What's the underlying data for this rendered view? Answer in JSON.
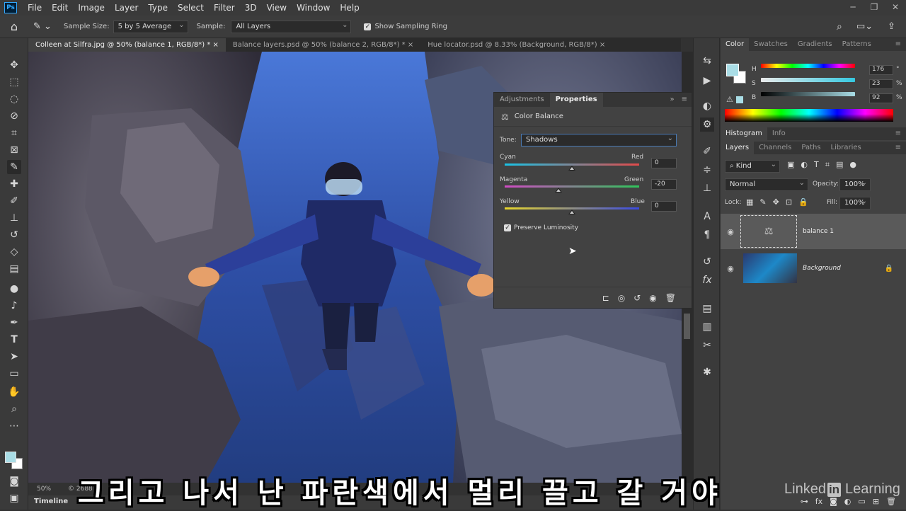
{
  "menu": {
    "logo": "Ps",
    "items": [
      "File",
      "Edit",
      "Image",
      "Layer",
      "Type",
      "Select",
      "Filter",
      "3D",
      "View",
      "Window",
      "Help"
    ]
  },
  "window_controls": [
    "─",
    "❐",
    "✕"
  ],
  "options": {
    "sample_size_label": "Sample Size:",
    "sample_size_value": "5 by 5 Average",
    "sample_label": "Sample:",
    "sample_value": "All Layers",
    "show_ring_label": "Show Sampling Ring"
  },
  "tabs": [
    {
      "label": "Colleen at Silfra.jpg @ 50% (balance 1, RGB/8*) *",
      "close": "×"
    },
    {
      "label": "Balance layers.psd @ 50% (balance 2, RGB/8*) *",
      "close": "×"
    },
    {
      "label": "Hue locator.psd @ 8.33% (Background, RGB/8*)",
      "close": "×"
    }
  ],
  "properties": {
    "tab_adjustments": "Adjustments",
    "tab_properties": "Properties",
    "title": "Color Balance",
    "tone_label": "Tone:",
    "tone_value": "Shadows",
    "sliders": [
      {
        "left": "Cyan",
        "right": "Red",
        "value": "0",
        "pos": 0.5
      },
      {
        "left": "Magenta",
        "right": "Green",
        "value": "-20",
        "pos": 0.4
      },
      {
        "left": "Yellow",
        "right": "Blue",
        "value": "0",
        "pos": 0.5
      }
    ],
    "preserve_label": "Preserve Luminosity"
  },
  "color_panel": {
    "tabs": [
      "Color",
      "Swatches",
      "Gradients",
      "Patterns"
    ],
    "channels": [
      {
        "label": "H",
        "value": "176",
        "unit": "°",
        "pos": 0.49
      },
      {
        "label": "S",
        "value": "23",
        "unit": "%",
        "pos": 0.23
      },
      {
        "label": "B",
        "value": "92",
        "unit": "%",
        "pos": 0.92
      }
    ],
    "fg_color": "#a9dde6"
  },
  "histogram_tabs": [
    "Histogram",
    "Info"
  ],
  "layers_panel": {
    "tabs": [
      "Layers",
      "Channels",
      "Paths",
      "Libraries"
    ],
    "kind_label": "Kind",
    "blend_mode": "Normal",
    "opacity_label": "Opacity:",
    "opacity_value": "100%",
    "lock_label": "Lock:",
    "fill_label": "Fill:",
    "fill_value": "100%",
    "layers": [
      {
        "name": "balance 1",
        "selected": true
      },
      {
        "name": "Background",
        "selected": false
      }
    ]
  },
  "status": {
    "zoom": "50%",
    "doc": "© 2688 p"
  },
  "timeline_label": "Timeline",
  "caption": "그리고 나서 난 파란색에서 멀리 끌고 갈 거야",
  "watermark": {
    "linked": "Linked",
    "in": "in",
    "learning": "Learning"
  }
}
